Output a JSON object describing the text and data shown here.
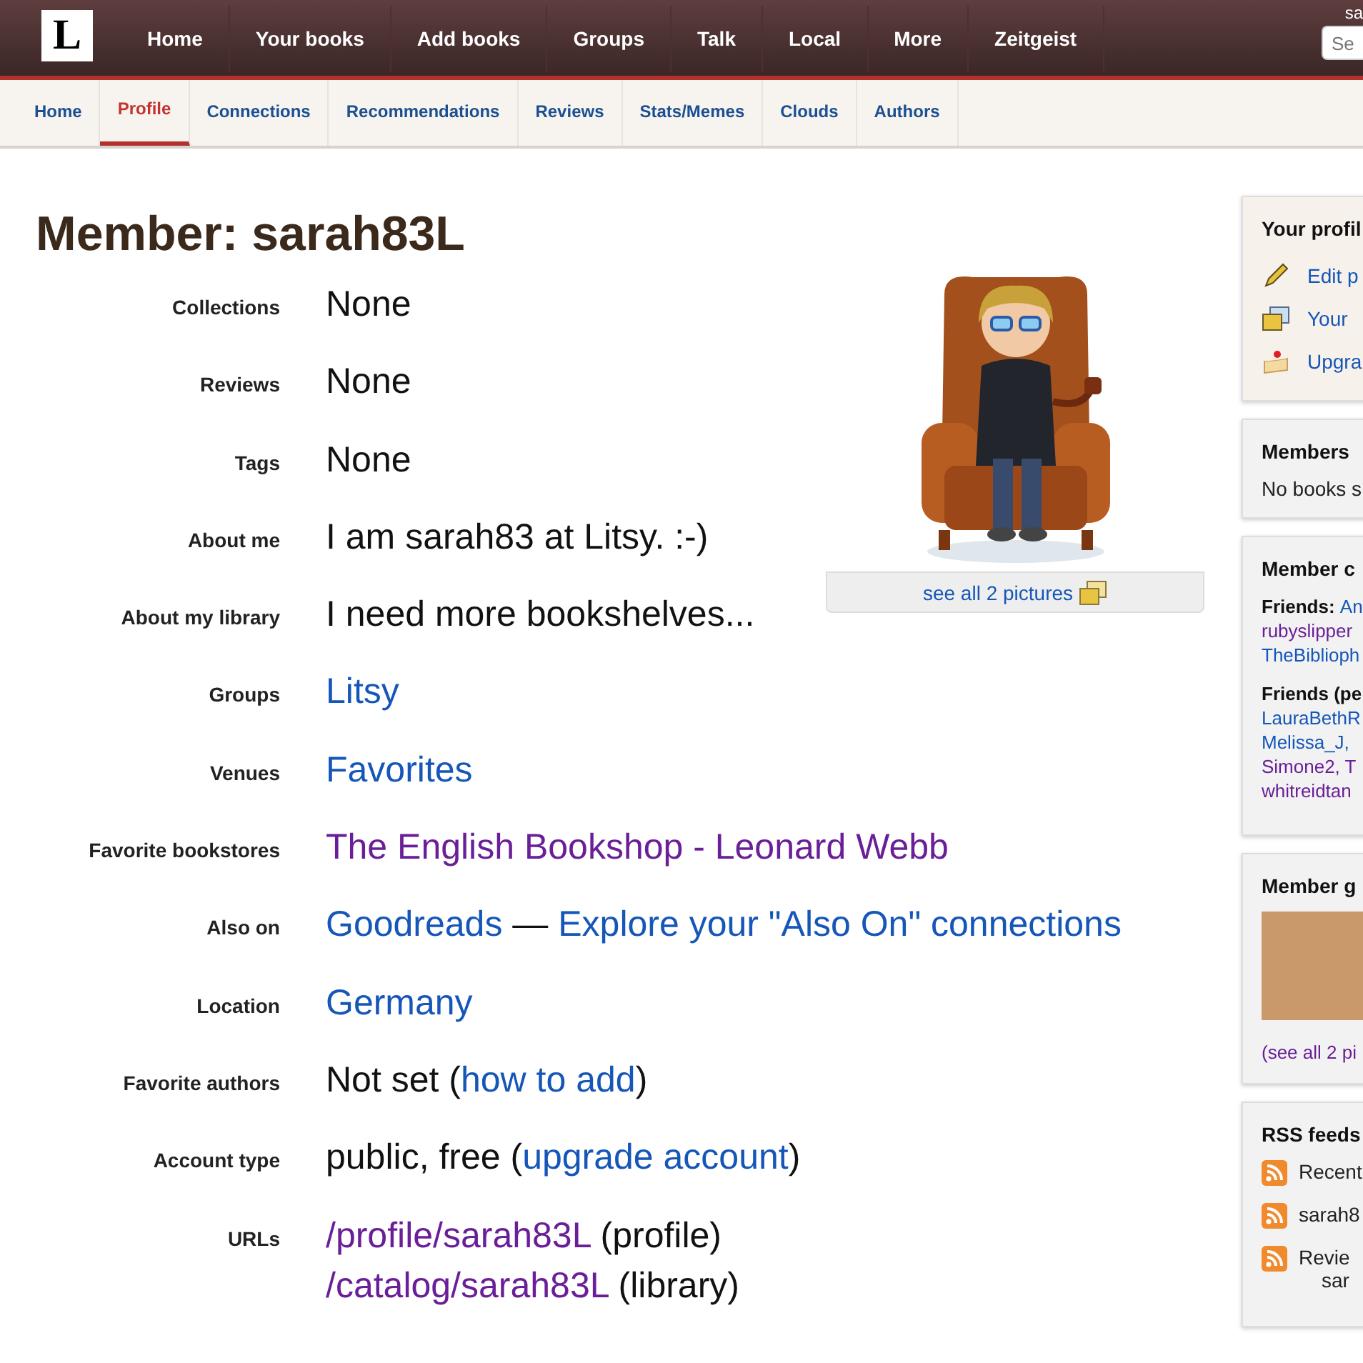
{
  "top_nav": {
    "items": [
      {
        "label": "Home"
      },
      {
        "label": "Your books"
      },
      {
        "label": "Add books"
      },
      {
        "label": "Groups"
      },
      {
        "label": "Talk"
      },
      {
        "label": "Local"
      },
      {
        "label": "More"
      },
      {
        "label": "Zeitgeist"
      }
    ],
    "user": "sa",
    "search": {
      "placeholder": "Se"
    }
  },
  "logo": "L",
  "tabs": [
    {
      "label": "Home",
      "selected": false
    },
    {
      "label": "Profile",
      "selected": true
    },
    {
      "label": "Connections",
      "selected": false
    },
    {
      "label": "Recommendations",
      "selected": false
    },
    {
      "label": "Reviews",
      "selected": false
    },
    {
      "label": "Stats/Memes",
      "selected": false
    },
    {
      "label": "Clouds",
      "selected": false
    },
    {
      "label": "Authors",
      "selected": false
    }
  ],
  "title": "Member: sarah83L",
  "picture": {
    "caption": "see all 2 pictures"
  },
  "rows": [
    {
      "label": "Collections",
      "lines": [
        [
          {
            "text": "None",
            "kind": "plain"
          }
        ]
      ]
    },
    {
      "label": "Reviews",
      "lines": [
        [
          {
            "text": "None",
            "kind": "plain"
          }
        ]
      ]
    },
    {
      "label": "Tags",
      "lines": [
        [
          {
            "text": "None",
            "kind": "plain"
          }
        ]
      ]
    },
    {
      "label": "About me",
      "lines": [
        [
          {
            "text": "I am sarah83 at Litsy. :-)",
            "kind": "plain"
          }
        ]
      ]
    },
    {
      "label": "About my library",
      "lines": [
        [
          {
            "text": "I need more bookshelves...",
            "kind": "plain"
          }
        ]
      ]
    },
    {
      "label": "Groups",
      "lines": [
        [
          {
            "text": "Litsy",
            "kind": "link"
          }
        ]
      ]
    },
    {
      "label": "Venues",
      "lines": [
        [
          {
            "text": "Favorites",
            "kind": "link"
          }
        ]
      ]
    },
    {
      "label": "Favorite bookstores",
      "lines": [
        [
          {
            "text": "The English Bookshop - Leonard Webb",
            "kind": "visited"
          }
        ]
      ]
    },
    {
      "label": "Also on",
      "lines": [
        [
          {
            "text": "Goodreads",
            "kind": "link"
          },
          {
            "text": " — ",
            "kind": "plain"
          },
          {
            "text": "Explore your \"Also On\" connections",
            "kind": "link"
          }
        ]
      ]
    },
    {
      "label": "Location",
      "lines": [
        [
          {
            "text": "Germany",
            "kind": "link"
          }
        ]
      ]
    },
    {
      "label": "Favorite authors",
      "lines": [
        [
          {
            "text": "Not set (",
            "kind": "plain"
          },
          {
            "text": "how to add",
            "kind": "link"
          },
          {
            "text": ")",
            "kind": "plain"
          }
        ]
      ]
    },
    {
      "label": "Account type",
      "lines": [
        [
          {
            "text": "public, free (",
            "kind": "plain"
          },
          {
            "text": "upgrade account",
            "kind": "link"
          },
          {
            "text": ")",
            "kind": "plain"
          }
        ]
      ]
    },
    {
      "label": "URLs",
      "lines": [
        [
          {
            "text": "/profile/sarah83L",
            "kind": "visited"
          },
          {
            "text": " (profile)",
            "kind": "plain"
          }
        ],
        [
          {
            "text": "/catalog/sarah83L",
            "kind": "visited"
          },
          {
            "text": " (library)",
            "kind": "plain"
          }
        ]
      ]
    }
  ],
  "sidebar": [
    {
      "kind": "links",
      "title": "Your profil",
      "items": [
        {
          "kind": "pencil",
          "label": "Edit p"
        },
        {
          "kind": "pictures",
          "label": "Your"
        },
        {
          "kind": "cake",
          "label": "Upgra"
        }
      ]
    },
    {
      "kind": "text",
      "title": "Members",
      "text": "No books s"
    },
    {
      "kind": "friends",
      "title": "Member c",
      "groups": [
        {
          "lines": [
            [
              {
                "text": "Friends: ",
                "kind": "heading"
              },
              {
                "text": "An",
                "kind": "link"
              }
            ],
            [
              {
                "text": "rubyslipper",
                "kind": "visited"
              }
            ],
            [
              {
                "text": "TheBiblioph",
                "kind": "link"
              }
            ]
          ]
        },
        {
          "lines": [
            [
              {
                "text": "Friends (pe",
                "kind": "heading"
              }
            ],
            [
              {
                "text": "LauraBethR",
                "kind": "link"
              }
            ],
            [
              {
                "text": "Melissa_J,",
                "kind": "link"
              }
            ],
            [
              {
                "text": "Simone2, T",
                "kind": "visited"
              }
            ],
            [
              {
                "text": "whitreidtan",
                "kind": "visited"
              }
            ]
          ]
        }
      ]
    },
    {
      "kind": "gallery",
      "title": "Member g",
      "link": "(see all 2 pi"
    },
    {
      "kind": "feeds",
      "title": "RSS feeds",
      "items": [
        {
          "label": "Recent"
        },
        {
          "label": "sarah8"
        },
        {
          "label": "Revie",
          "extra": "sar"
        }
      ]
    }
  ]
}
